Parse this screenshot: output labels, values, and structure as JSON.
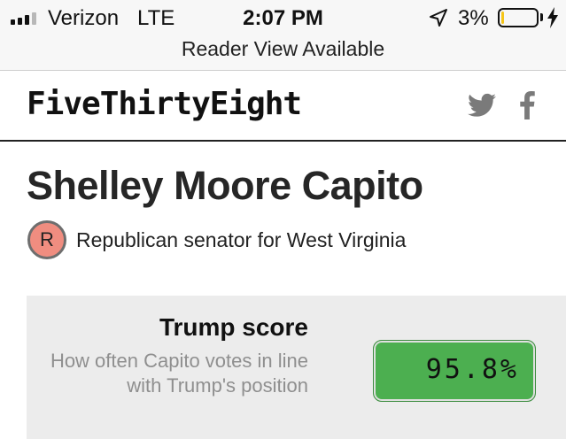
{
  "status_bar": {
    "carrier": "Verizon",
    "network": "LTE",
    "time": "2:07 PM",
    "battery_percent": "3%",
    "battery_level": 0.06,
    "battery_color": "#f5c518",
    "icons": [
      "signal-icon",
      "location-arrow-icon",
      "battery-icon",
      "charging-bolt-icon"
    ]
  },
  "reader_bar": {
    "text": "Reader View Available"
  },
  "header": {
    "logo": "FiveThirtyEight",
    "icons": [
      "twitter-icon",
      "facebook-icon"
    ]
  },
  "senator": {
    "name": "Shelley Moore Capito",
    "party_letter": "R",
    "party_color": "#f08d80",
    "description": "Republican senator for West Virginia"
  },
  "score": {
    "title": "Trump score",
    "description": "How often Capito votes in line with Trump's position",
    "value": "95.8%",
    "box_color": "#4caf50"
  }
}
